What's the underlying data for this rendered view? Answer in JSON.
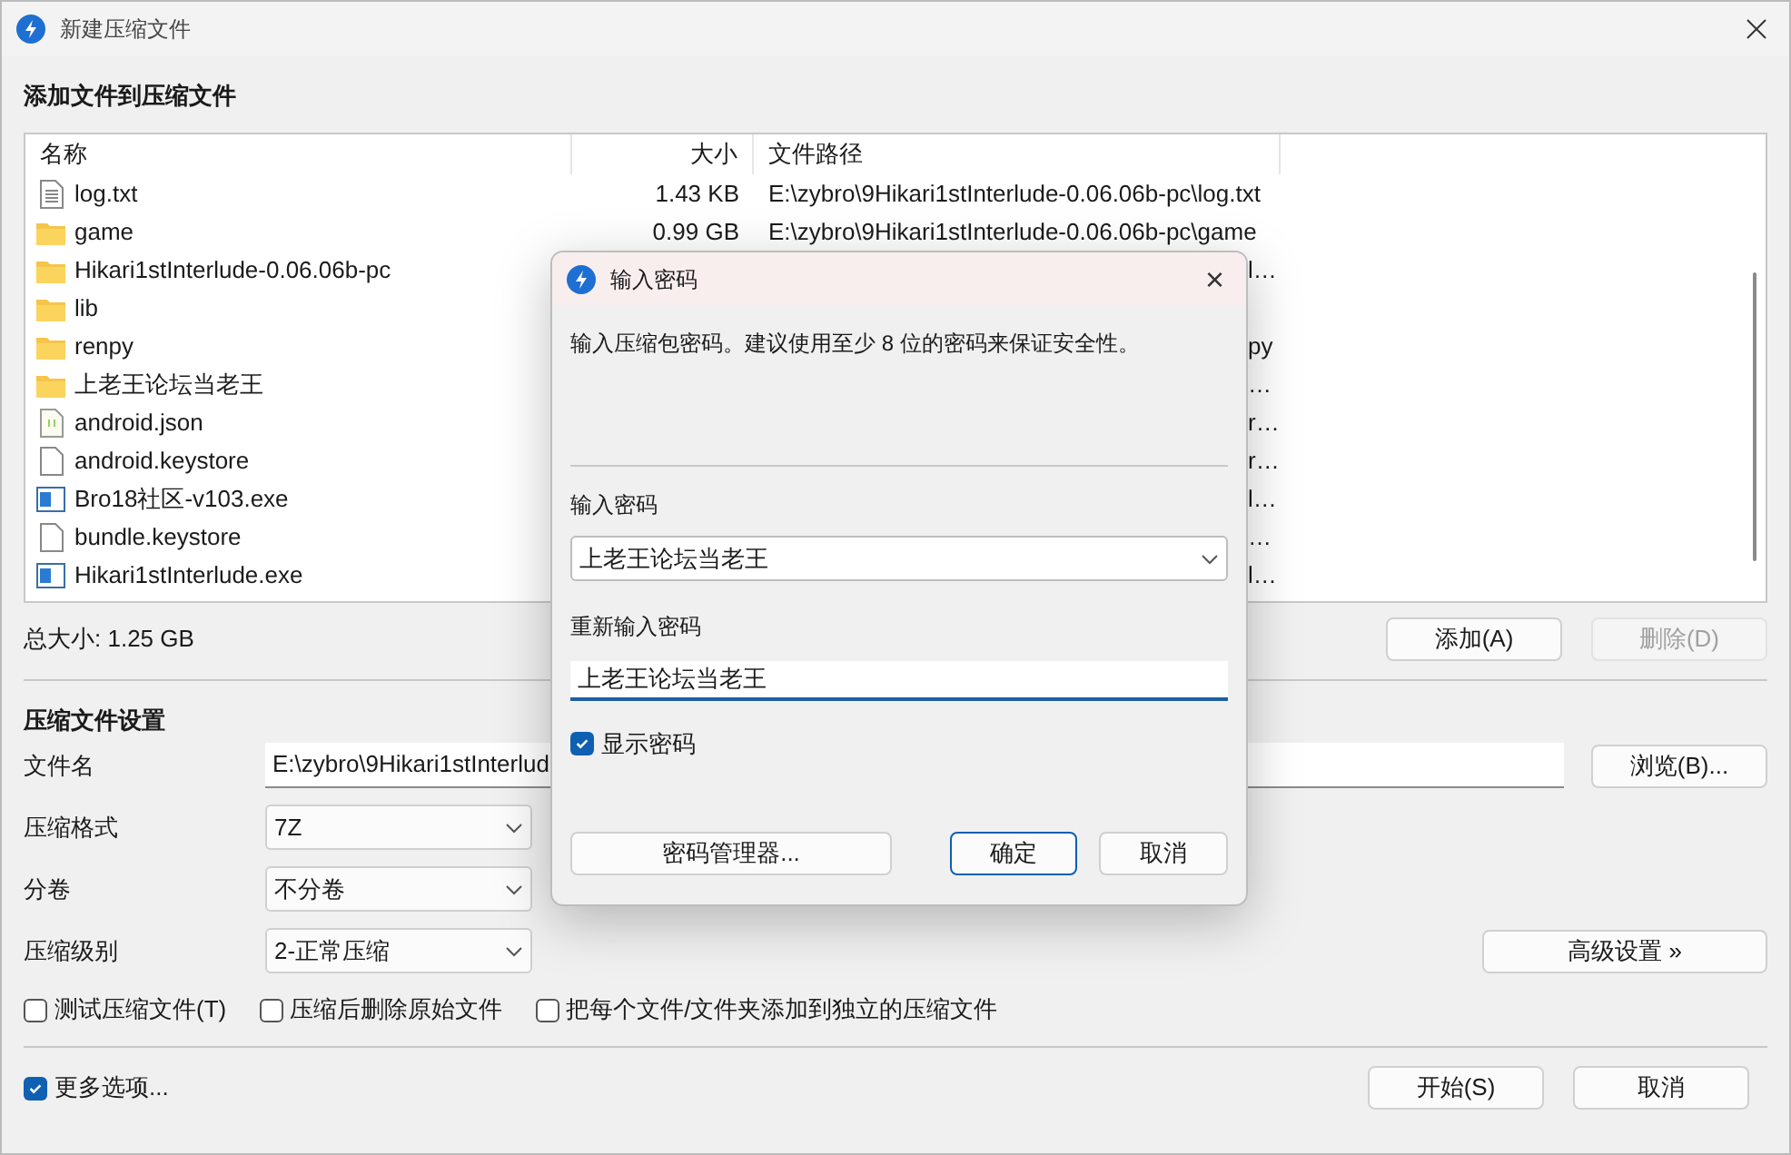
{
  "window": {
    "title": "新建压缩文件"
  },
  "files_section": {
    "title": "添加文件到压缩文件"
  },
  "table": {
    "columns": [
      "名称",
      "大小",
      "文件路径"
    ],
    "rows": [
      {
        "kind": "text",
        "name": "log.txt",
        "size": "1.43 KB",
        "path": "E:\\zybro\\9Hikari1stInterlude-0.06.06b-pc\\log.txt"
      },
      {
        "kind": "folder",
        "name": "game",
        "size": "0.99 GB",
        "path": "E:\\zybro\\9Hikari1stInterlude-0.06.06b-pc\\game"
      },
      {
        "kind": "folder",
        "name": "Hikari1stInterlude-0.06.06b-pc",
        "path": "l…"
      },
      {
        "kind": "folder",
        "name": "lib"
      },
      {
        "kind": "folder",
        "name": "renpy",
        "path": "py"
      },
      {
        "kind": "folder",
        "name": "上老王论坛当老王",
        "path": "…"
      },
      {
        "kind": "json",
        "name": "android.json",
        "path": "r…"
      },
      {
        "kind": "file",
        "name": "android.keystore",
        "path": "r…"
      },
      {
        "kind": "exe",
        "name": "Bro18社区-v103.exe",
        "path": "l…"
      },
      {
        "kind": "file",
        "name": "bundle.keystore",
        "path": "…"
      },
      {
        "kind": "exe",
        "name": "Hikari1stInterlude.exe",
        "path": "l…"
      }
    ]
  },
  "total_size": "总大小: 1.25 GB",
  "list_buttons": [
    {
      "label": "添加(A)",
      "disabled": false
    },
    {
      "label": "删除(D)",
      "disabled": true
    }
  ],
  "settings": {
    "title": "压缩文件设置",
    "filename": {
      "label": "文件名",
      "value": "E:\\zybro\\9Hikari1stInterlud",
      "browse": "浏览(B)..."
    },
    "selects": [
      {
        "label": "压缩格式",
        "value": "7Z"
      },
      {
        "label": "分卷",
        "value": "不分卷"
      },
      {
        "label": "压缩级别",
        "value": "2-正常压缩"
      }
    ],
    "advanced": "高级设置 »",
    "options": [
      {
        "label": "测试压缩文件(T)",
        "checked": false
      },
      {
        "label": "压缩后删除原始文件",
        "checked": false
      },
      {
        "label": "把每个文件/文件夹添加到独立的压缩文件",
        "checked": false
      }
    ]
  },
  "more_options": {
    "label": "更多选项...",
    "checked": true
  },
  "footer_buttons": [
    "开始(S)",
    "取消"
  ],
  "dialog": {
    "title": "输入密码",
    "close": "×",
    "message": "输入压缩包密码。建议使用至少 8 位的密码来保证安全性。",
    "password_label": "输入密码",
    "password": "上老王论坛当老王",
    "confirm_label": "重新输入密码",
    "confirm": "上老王论坛当老王",
    "show_password": {
      "label": "显示密码",
      "checked": true
    },
    "manager": "密码管理器...",
    "ok": "确定",
    "cancel": "取消"
  }
}
